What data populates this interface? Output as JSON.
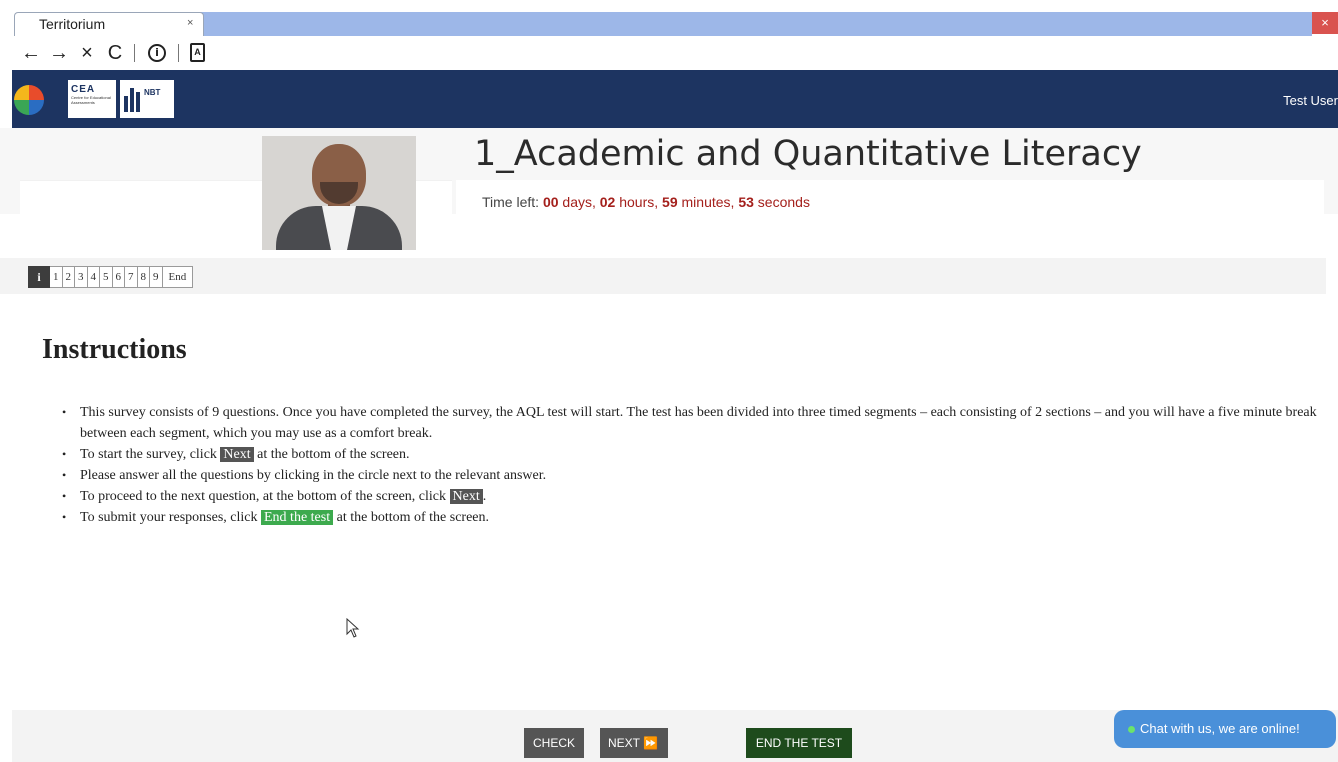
{
  "browser": {
    "tab_title": "Territorium",
    "tab_close": "×",
    "window_close": "×",
    "nav_back": "←",
    "nav_forward": "→",
    "nav_stop": "×",
    "nav_reload": "C",
    "info_glyph": "i",
    "doc_glyph": "A"
  },
  "header": {
    "logos": [
      "CEA",
      "NBT"
    ],
    "cea_label": "CEA",
    "cea_sub": "Centre for Educational Assessments",
    "nbt_label": "NBT",
    "user_name": "Test User",
    "colors": {
      "header_bg": "#1d3461"
    }
  },
  "test": {
    "title": "1_Academic and Quantitative Literacy",
    "timer": {
      "prefix": "Time left:",
      "days": "00",
      "days_unit": "days,",
      "hours": "02",
      "hours_unit": "hours,",
      "minutes": "59",
      "minutes_unit": "minutes,",
      "seconds": "53",
      "seconds_unit": "seconds"
    }
  },
  "question_nav": {
    "info_label": "i",
    "items": [
      "1",
      "2",
      "3",
      "4",
      "5",
      "6",
      "7",
      "8",
      "9",
      "End"
    ]
  },
  "instructions": {
    "heading": "Instructions",
    "items": [
      "This survey consists of 9 questions. Once you have completed the survey, the AQL test will start. The test has been divided into three timed segments – each consisting of 2 sections – and you will have a five minute break between each segment, which you may use as a comfort break.",
      {
        "before": "To start the survey, click ",
        "tag": "Next",
        "after": " at the bottom of the screen."
      },
      "Please answer all the questions by clicking in the circle next to the relevant answer.",
      {
        "before": "To proceed to the next question, at the bottom of the screen, click ",
        "tag": "Next",
        "after": "."
      },
      {
        "before": "To submit your responses, click ",
        "tag": "End the test",
        "after": " at the bottom of the screen."
      }
    ]
  },
  "footer": {
    "check_label": "CHECK",
    "next_label": "NEXT ⏩",
    "end_label": "END THE TEST",
    "chat_label": "Chat with us, we are online!"
  }
}
